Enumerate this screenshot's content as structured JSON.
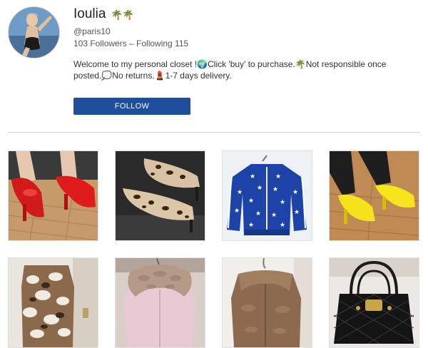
{
  "profile": {
    "name": "Ioulia",
    "name_icon": "palm-tree-icon",
    "handle": "@paris10",
    "stats": "103 Followers – Following 115",
    "bio": "Welcome to my personal closet !🌍Click 'buy' to purchase.🌴Not responsible once posted.💭No returns.💄1-7 days delivery."
  },
  "actions": {
    "follow_label": "FOLLOW"
  },
  "colors": {
    "follow_button": "#1f4e9c",
    "divider": "#d6d6d6"
  },
  "items": [
    {
      "depicts": "red patent platform heels"
    },
    {
      "depicts": "leopard print pumps"
    },
    {
      "depicts": "blue star track jacket"
    },
    {
      "depicts": "yellow patent platform heels"
    },
    {
      "depicts": "patchwork fur vest"
    },
    {
      "depicts": "pink fur collar jacket"
    },
    {
      "depicts": "brown shearling jacket"
    },
    {
      "depicts": "black quilted handbag"
    }
  ]
}
